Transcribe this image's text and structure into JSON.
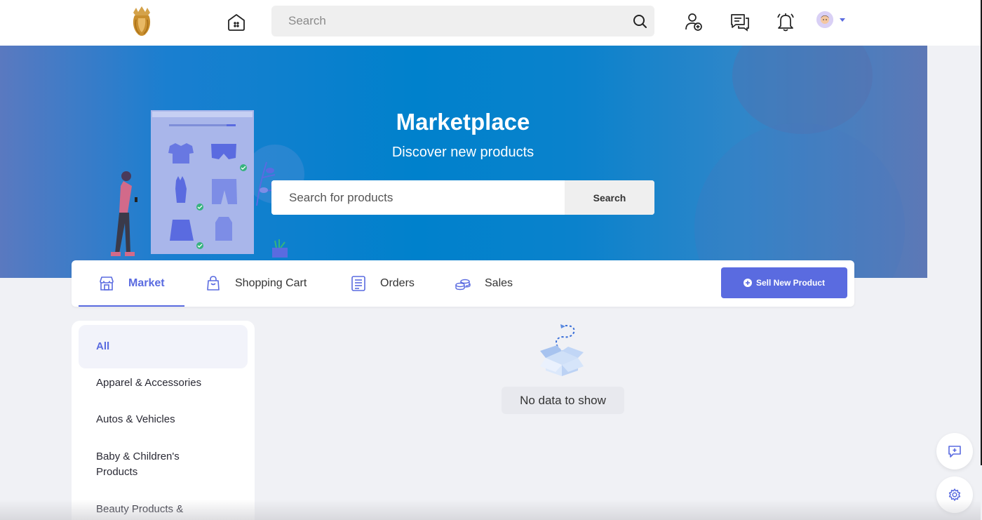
{
  "topbar": {
    "search_placeholder": "Search",
    "icons": [
      "lion-logo-icon",
      "home-icon",
      "search-icon",
      "add-friend-icon",
      "messages-icon",
      "bell-icon",
      "avatar",
      "chevron-down-icon"
    ]
  },
  "hero": {
    "title": "Marketplace",
    "subtitle": "Discover new products",
    "search_placeholder": "Search for products",
    "search_button": "Search"
  },
  "tabs": [
    {
      "label": "Market",
      "icon": "store-icon",
      "active": true
    },
    {
      "label": "Shopping Cart",
      "icon": "shopping-bag-icon",
      "active": false
    },
    {
      "label": "Orders",
      "icon": "document-icon",
      "active": false
    },
    {
      "label": "Sales",
      "icon": "coins-icon",
      "active": false
    }
  ],
  "sell_button": "Sell New Product",
  "categories": [
    {
      "label": "All",
      "active": true
    },
    {
      "label": "Apparel & Accessories",
      "active": false
    },
    {
      "label": "Autos & Vehicles",
      "active": false
    },
    {
      "label": "Baby & Children's Products",
      "active": false
    },
    {
      "label": "Beauty Products &",
      "active": false
    }
  ],
  "empty_state": {
    "message": "No data to show",
    "icon": "empty-box-icon"
  },
  "floating": [
    "chat-plus-icon",
    "gear-icon"
  ],
  "colors": {
    "accent": "#5a6be0",
    "hero_blue": "#0081cc"
  }
}
